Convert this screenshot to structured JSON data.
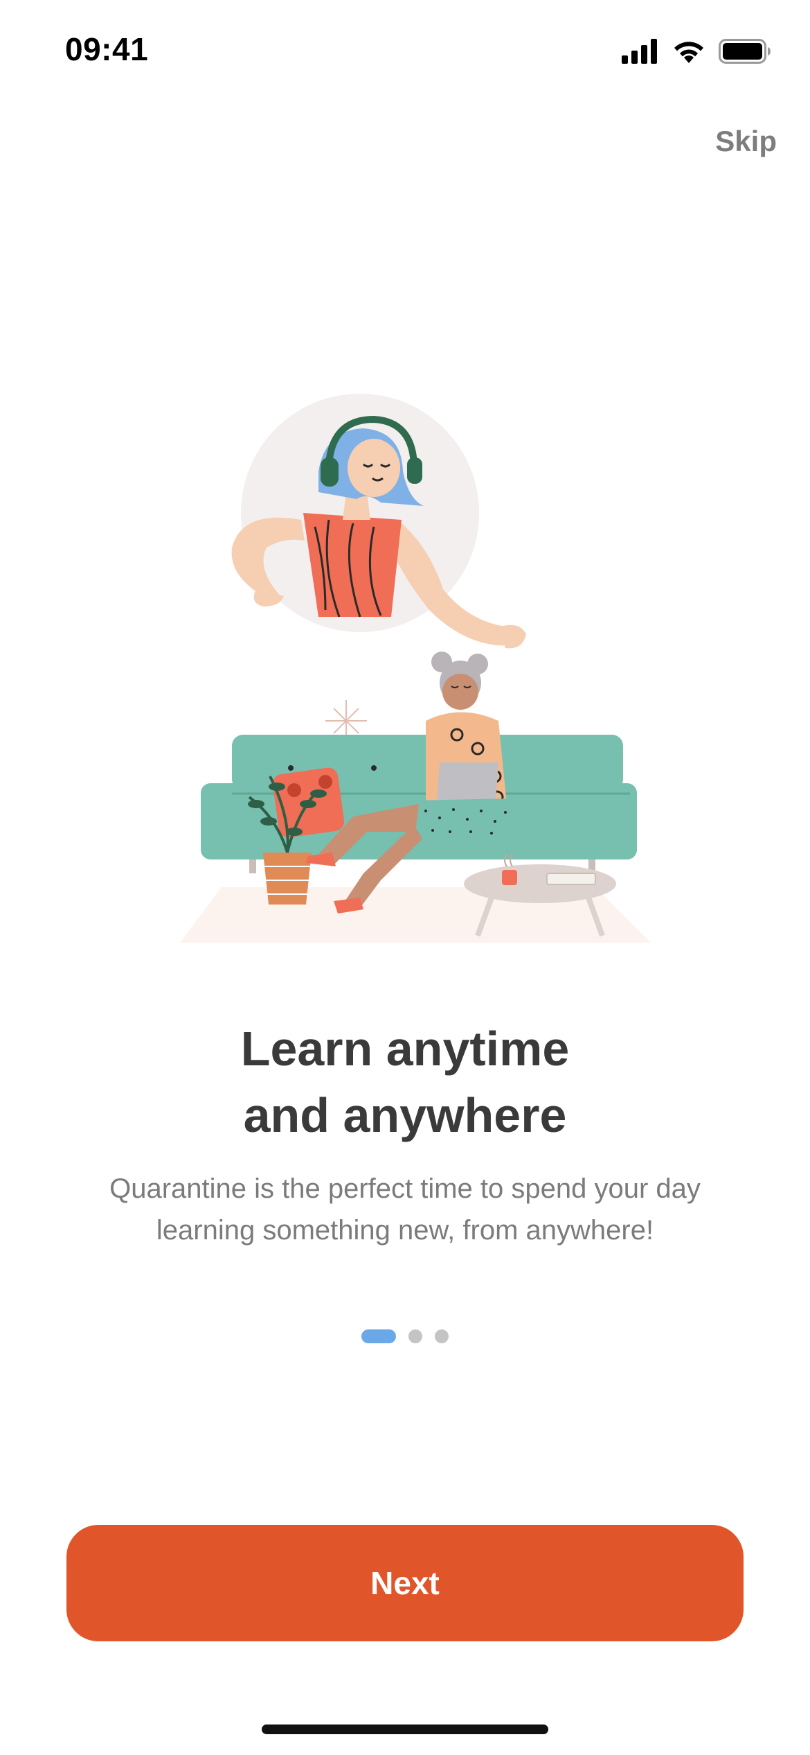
{
  "status_bar": {
    "time": "09:41",
    "icons": [
      "cellular-signal-icon",
      "wifi-icon",
      "battery-icon"
    ]
  },
  "skip_label": "Skip",
  "headline": {
    "line1": "Learn anytime",
    "line2": "and anywhere"
  },
  "description": "Quarantine is the perfect time to spend your day learning something new, from anywhere!",
  "pagination": {
    "total": 3,
    "active_index": 0
  },
  "next_label": "Next",
  "colors": {
    "accent": "#e0552a",
    "active_dot": "#6aa8e8",
    "inactive_dot": "#c4c4c4",
    "sofa": "#77bfae",
    "heading": "#3a3a3a",
    "body_text": "#7b7b7b"
  }
}
